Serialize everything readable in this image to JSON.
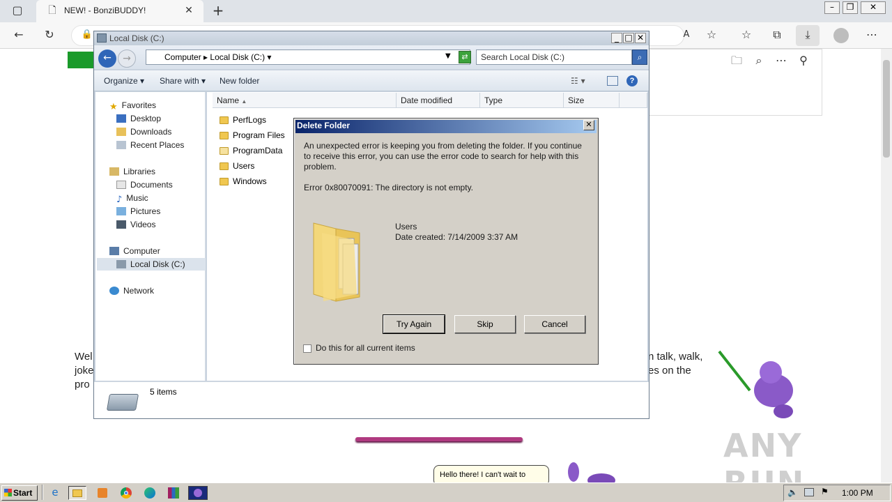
{
  "browser": {
    "tab_title": "NEW! - BonziBUDDY!",
    "new_tab": "+",
    "icons": [
      "tab-actions-icon",
      "page-icon",
      "close-tab-icon",
      "back-icon",
      "refresh-icon",
      "lock-icon",
      "read-aloud-icon",
      "add-favorite-icon",
      "favorites-icon",
      "collections-icon",
      "downloads-icon",
      "profile-icon",
      "more-icon"
    ]
  },
  "webpage": {
    "intro_left": [
      "Wel",
      "joke",
      "pro"
    ],
    "intro_right": [
      "n talk, walk,",
      "es on the"
    ],
    "bubble_text": "Hello there! I can't wait to",
    "watermark": "ANY RUN"
  },
  "explorer": {
    "title": "Local Disk (C:)",
    "breadcrumb": [
      "Computer",
      "Local Disk (C:)"
    ],
    "search_placeholder": "Search Local Disk (C:)",
    "commands": {
      "organize": "Organize",
      "share": "Share with",
      "new_folder": "New folder"
    },
    "nav": {
      "favorites": "Favorites",
      "desktop": "Desktop",
      "downloads": "Downloads",
      "recent": "Recent Places",
      "libraries": "Libraries",
      "documents": "Documents",
      "music": "Music",
      "pictures": "Pictures",
      "videos": "Videos",
      "computer": "Computer",
      "local_disk": "Local Disk (C:)",
      "network": "Network"
    },
    "columns": {
      "name": "Name",
      "date": "Date modified",
      "type": "Type",
      "size": "Size"
    },
    "files": [
      "PerfLogs",
      "Program Files",
      "ProgramData",
      "Users",
      "Windows"
    ],
    "status": "5 items"
  },
  "dialog": {
    "title": "Delete Folder",
    "message": "An unexpected error is keeping you from deleting the folder. If you continue to receive this error, you can use the error code to search for help with this problem.",
    "error": "Error 0x80070091: The directory is not empty.",
    "item_name": "Users",
    "item_date": "Date created: 7/14/2009 3:37 AM",
    "buttons": {
      "try_again": "Try Again",
      "skip": "Skip",
      "cancel": "Cancel"
    },
    "checkbox_label": "Do this for all current items"
  },
  "taskbar": {
    "start": "Start",
    "clock": "1:00 PM"
  }
}
